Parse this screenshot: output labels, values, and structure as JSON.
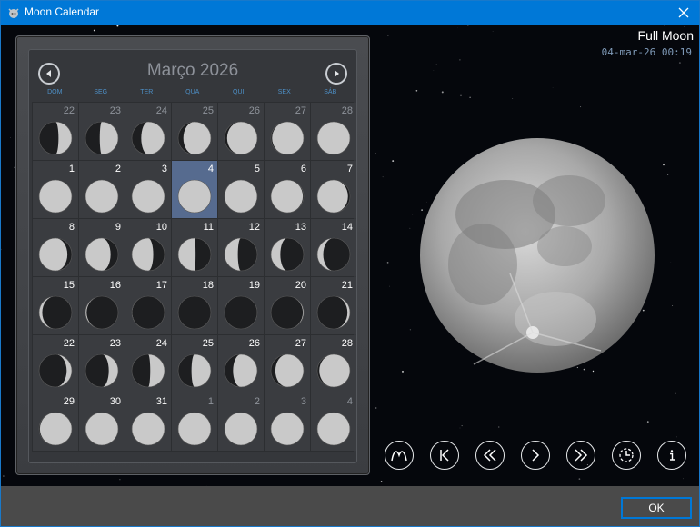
{
  "window": {
    "title": "Moon Calendar"
  },
  "current_phase": {
    "name": "Full Moon",
    "datetime": "04-mar-26 00:19"
  },
  "calendar": {
    "month_title": "Março 2026",
    "weekdays": [
      "DOM",
      "SEG",
      "TER",
      "QUA",
      "QUI",
      "SEX",
      "SÁB"
    ],
    "days": [
      {
        "day": "22",
        "other": true,
        "phase": 0.22
      },
      {
        "day": "23",
        "other": true,
        "phase": 0.27
      },
      {
        "day": "24",
        "other": true,
        "phase": 0.32
      },
      {
        "day": "25",
        "other": true,
        "phase": 0.37
      },
      {
        "day": "26",
        "other": true,
        "phase": 0.41
      },
      {
        "day": "27",
        "other": true,
        "phase": 0.44
      },
      {
        "day": "28",
        "other": true,
        "phase": 0.47
      },
      {
        "day": "1",
        "other": false,
        "phase": 0.48
      },
      {
        "day": "2",
        "other": false,
        "phase": 0.49
      },
      {
        "day": "3",
        "other": false,
        "phase": 0.5
      },
      {
        "day": "4",
        "other": false,
        "today": true,
        "phase": 0.5
      },
      {
        "day": "5",
        "other": false,
        "phase": 0.52
      },
      {
        "day": "6",
        "other": false,
        "phase": 0.55
      },
      {
        "day": "7",
        "other": false,
        "phase": 0.58
      },
      {
        "day": "8",
        "other": false,
        "phase": 0.62
      },
      {
        "day": "9",
        "other": false,
        "phase": 0.66
      },
      {
        "day": "10",
        "other": false,
        "phase": 0.7
      },
      {
        "day": "11",
        "other": false,
        "phase": 0.74
      },
      {
        "day": "12",
        "other": false,
        "phase": 0.78
      },
      {
        "day": "13",
        "other": false,
        "phase": 0.82
      },
      {
        "day": "14",
        "other": false,
        "phase": 0.86
      },
      {
        "day": "15",
        "other": false,
        "phase": 0.9
      },
      {
        "day": "16",
        "other": false,
        "phase": 0.94
      },
      {
        "day": "17",
        "other": false,
        "phase": 0.97
      },
      {
        "day": "18",
        "other": false,
        "phase": 0.99
      },
      {
        "day": "19",
        "other": false,
        "phase": 0.02
      },
      {
        "day": "20",
        "other": false,
        "phase": 0.05
      },
      {
        "day": "21",
        "other": false,
        "phase": 0.09
      },
      {
        "day": "22",
        "other": false,
        "phase": 0.13
      },
      {
        "day": "23",
        "other": false,
        "phase": 0.18
      },
      {
        "day": "24",
        "other": false,
        "phase": 0.23
      },
      {
        "day": "25",
        "other": false,
        "phase": 0.28
      },
      {
        "day": "26",
        "other": false,
        "phase": 0.33
      },
      {
        "day": "27",
        "other": false,
        "phase": 0.38
      },
      {
        "day": "28",
        "other": false,
        "phase": 0.42
      },
      {
        "day": "29",
        "other": false,
        "phase": 0.45
      },
      {
        "day": "30",
        "other": false,
        "phase": 0.47
      },
      {
        "day": "31",
        "other": false,
        "phase": 0.48
      },
      {
        "day": "1",
        "other": true,
        "phase": 0.49
      },
      {
        "day": "2",
        "other": true,
        "phase": 0.5
      },
      {
        "day": "3",
        "other": true,
        "phase": 0.51
      },
      {
        "day": "4",
        "other": true,
        "phase": 0.53
      }
    ]
  },
  "toolbar": [
    {
      "name": "phase-mode-button",
      "icon": "arch-icon"
    },
    {
      "name": "first-button",
      "icon": "skip-back-icon"
    },
    {
      "name": "fast-back-button",
      "icon": "double-chevron-left-icon"
    },
    {
      "name": "next-button",
      "icon": "chevron-right-icon"
    },
    {
      "name": "fast-forward-button",
      "icon": "double-chevron-right-icon"
    },
    {
      "name": "clock-button",
      "icon": "clock-icon"
    },
    {
      "name": "info-button",
      "icon": "info-icon"
    }
  ],
  "footer": {
    "ok_label": "OK"
  },
  "colors": {
    "titlebar": "#0078d7",
    "today_highlight": "#566b8f",
    "weekday_text": "#4d8fc6"
  }
}
